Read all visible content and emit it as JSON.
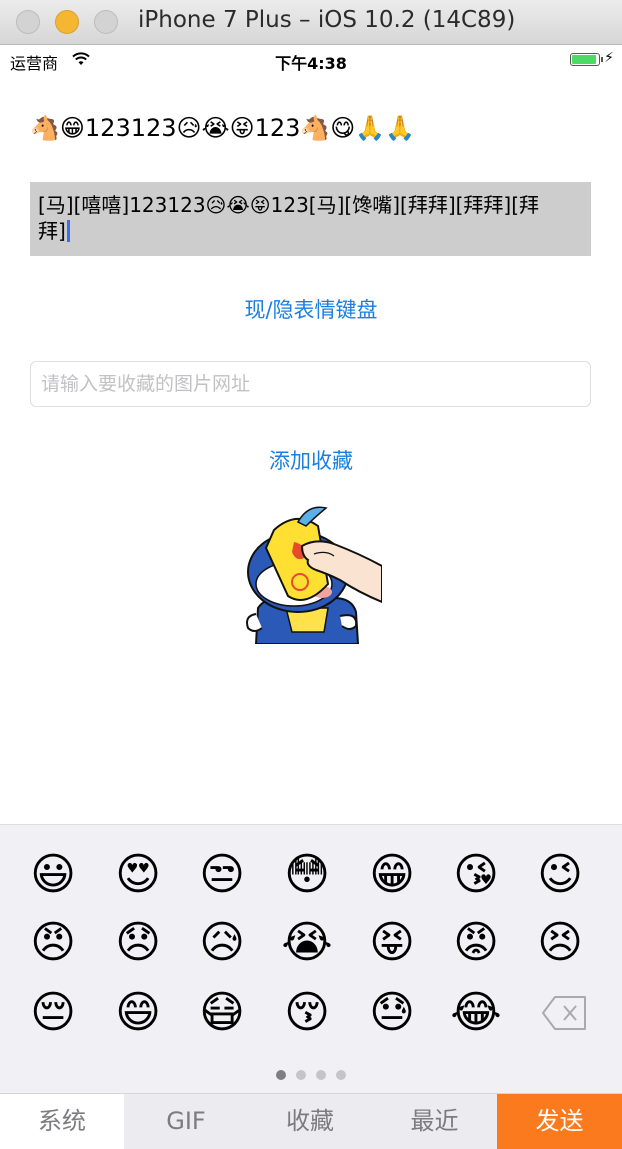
{
  "window": {
    "title": "iPhone 7 Plus – iOS 10.2 (14C89)"
  },
  "status_bar": {
    "carrier": "运营商",
    "time": "下午4:38"
  },
  "content": {
    "rendered_text": "🐴😁123123😥😭😝123🐴😋🙏🙏",
    "input_text": "[马][嘻嘻]123123😥😭😝123[马][馋嘴][拜拜][拜拜][拜拜]",
    "toggle_keyboard_label": "现/隐表情键盘",
    "url_placeholder": "请输入要收藏的图片网址",
    "url_value": "",
    "add_favorite_label": "添加收藏"
  },
  "keyboard": {
    "row1": [
      "😃",
      "😍",
      "😒",
      "😳",
      "😁",
      "😘",
      "😉"
    ],
    "row2": [
      "😠",
      "😞",
      "😥",
      "😭",
      "😝",
      "😡",
      "😣"
    ],
    "row3": [
      "😔",
      "😄",
      "😷",
      "😚",
      "😓",
      "😂"
    ],
    "page_index": 1,
    "page_count": 4
  },
  "tabs": {
    "system": "系统",
    "gif": "GIF",
    "favorites": "收藏",
    "recent": "最近",
    "send": "发送"
  },
  "colors": {
    "accent": "#1a7fe0",
    "send": "#fb7a1d",
    "input_highlight": "#cdcdcd"
  }
}
